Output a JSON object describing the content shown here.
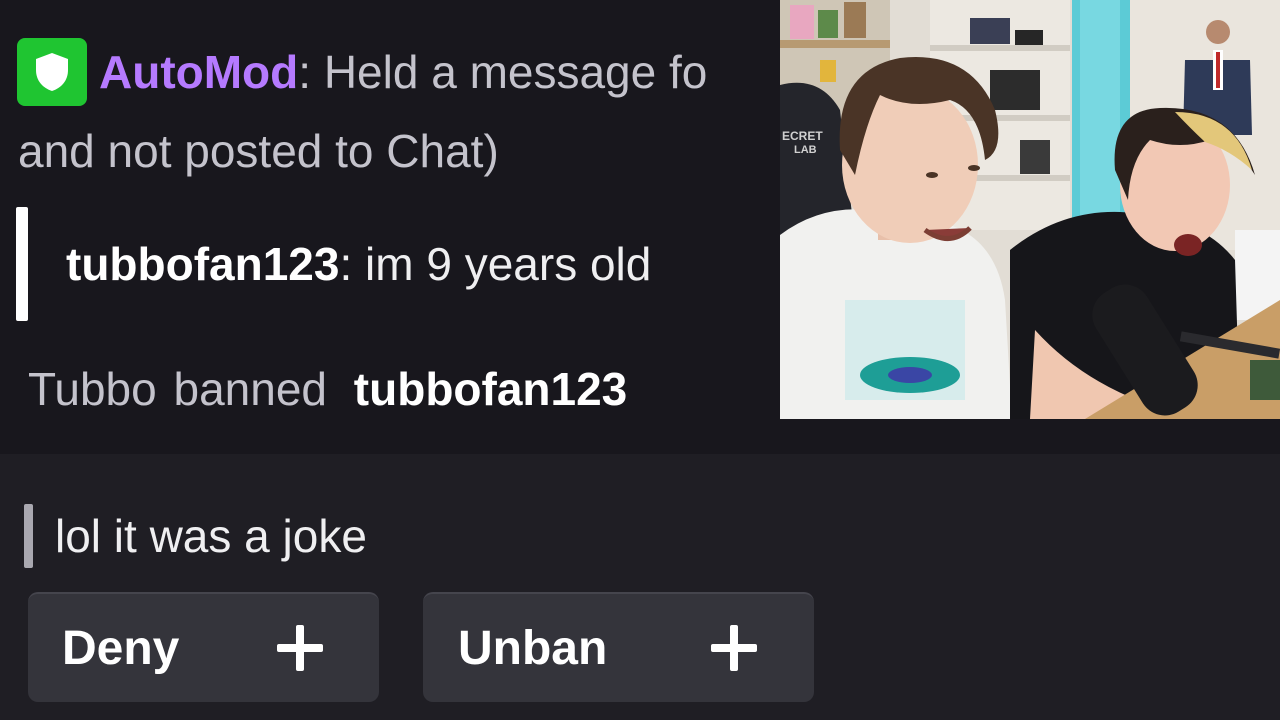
{
  "automod": {
    "name": "AutoMod",
    "text_line1": ": Held a message fo",
    "text_line2": "and not posted to Chat)",
    "badge_color": "#1fc531",
    "badge_icon": "shield-icon"
  },
  "held_message": {
    "username": "tubbofan123",
    "text": ": im 9 years old"
  },
  "ban_notice": {
    "actor": "Tubbo",
    "verb": "banned",
    "target": "tubbofan123"
  },
  "unban_request": {
    "reason": "lol it was a joke"
  },
  "actions": {
    "deny_label": "Deny",
    "unban_label": "Unban",
    "deny_icon": "plus-icon",
    "unban_icon": "plus-icon"
  },
  "webcam": {
    "content": "webcam-feed"
  },
  "colors": {
    "automod_name": "#b57aff",
    "background_top": "#18171d",
    "background_bottom": "#1f1e24",
    "button_bg": "#34343b"
  }
}
